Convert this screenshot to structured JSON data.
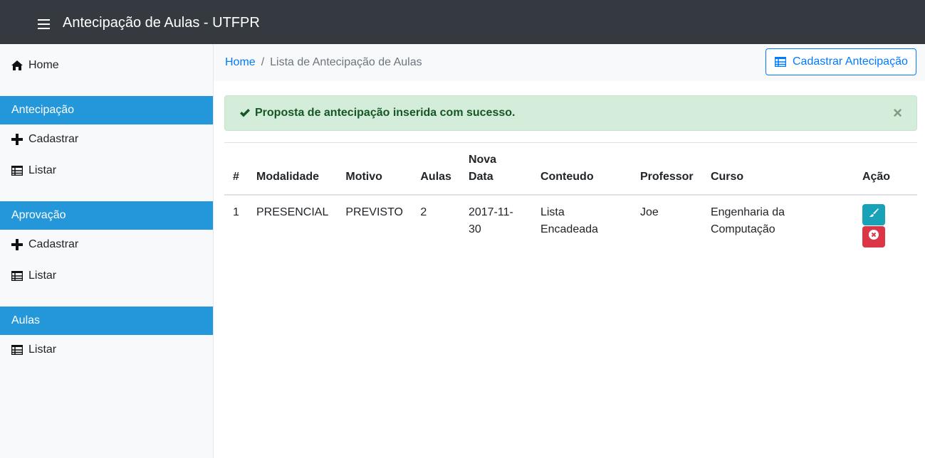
{
  "navbar": {
    "title": "Antecipação de Aulas - UTFPR"
  },
  "sidebar": {
    "home": "Home",
    "sections": [
      {
        "title": "Antecipação",
        "items": [
          "Cadastrar",
          "Listar"
        ]
      },
      {
        "title": "Aprovação",
        "items": [
          "Cadastrar",
          "Listar"
        ]
      },
      {
        "title": "Aulas",
        "items": [
          "Listar"
        ]
      }
    ]
  },
  "breadcrumb": {
    "home": "Home",
    "separator": "/",
    "current": "Lista de Antecipação de Aulas"
  },
  "actions": {
    "register": "Cadastrar Antecipação"
  },
  "alert": {
    "message": "Proposta de antecipação inserida com sucesso.",
    "close": "×"
  },
  "table": {
    "headers": [
      "#",
      "Modalidade",
      "Motivo",
      "Aulas",
      "Nova Data",
      "Conteudo",
      "Professor",
      "Curso",
      "Ação"
    ],
    "rows": [
      {
        "id": "1",
        "modalidade": "PRESENCIAL",
        "motivo": "PREVISTO",
        "aulas": "2",
        "nova_data": "2017-11-30",
        "conteudo": "Lista Encadeada",
        "professor": "Joe",
        "curso": "Engenharia da Computação"
      }
    ]
  },
  "colors": {
    "navbar": "#343a40",
    "sidebar_header": "#2497db",
    "primary": "#007bff",
    "success_bg": "#d4edda",
    "edit": "#17a2b8",
    "delete": "#dc3545"
  }
}
